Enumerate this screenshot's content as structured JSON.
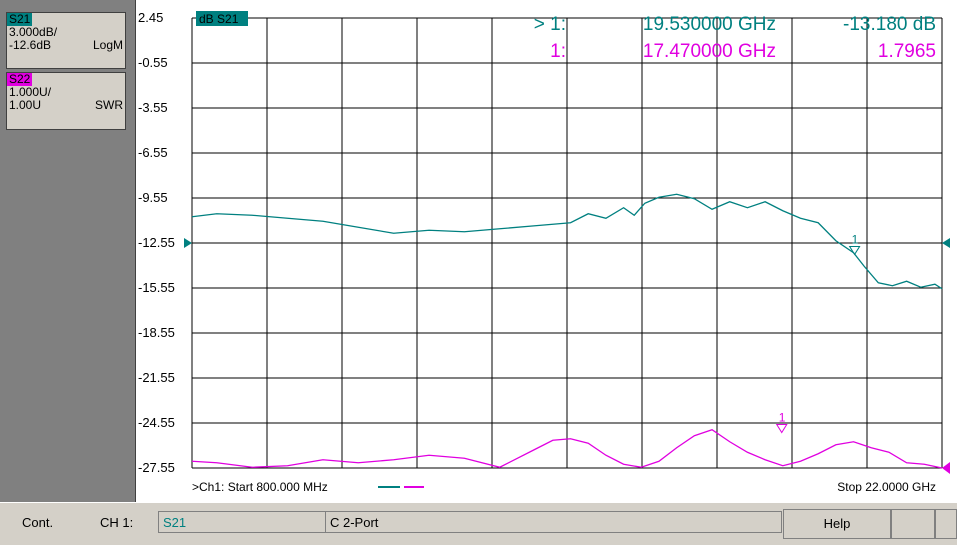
{
  "traces": [
    {
      "tag": "S21",
      "scale": "3.000dB/",
      "ref": "-12.6dB",
      "format": "LogM",
      "color": "#008080"
    },
    {
      "tag": "S22",
      "scale": "1.000U/",
      "ref": "1.00U",
      "format": "SWR",
      "color": "#e000e0"
    }
  ],
  "chart_data": {
    "type": "line",
    "title_tag": "dB S21",
    "y_ticks": [
      "2.45",
      "-0.55",
      "-3.55",
      "-6.55",
      "-9.55",
      "-12.55",
      "-15.55",
      "-18.55",
      "-21.55",
      "-24.55",
      "-27.55"
    ],
    "ylim": [
      -27.55,
      2.45
    ],
    "xlim": [
      0.8,
      22.0
    ],
    "x_unit": "GHz",
    "start_label": ">Ch1: Start  800.000 MHz",
    "stop_label": "Stop  22.0000 GHz",
    "series": [
      {
        "name": "S21",
        "color": "#008080",
        "x": [
          0.8,
          1.5,
          2.5,
          3.5,
          4.5,
          5.5,
          6.5,
          7.5,
          8.5,
          9.5,
          10.5,
          11.5,
          12.0,
          12.5,
          13.0,
          13.3,
          13.6,
          14.0,
          14.5,
          15.0,
          15.5,
          16.0,
          16.5,
          17.0,
          17.5,
          18.0,
          18.5,
          19.0,
          19.5,
          19.8,
          20.2,
          20.6,
          21.0,
          21.4,
          21.8,
          22.0
        ],
        "y": [
          -10.8,
          -10.6,
          -10.7,
          -10.9,
          -11.1,
          -11.5,
          -11.9,
          -11.7,
          -11.8,
          -11.6,
          -11.4,
          -11.2,
          -10.6,
          -10.9,
          -10.2,
          -10.7,
          -9.9,
          -9.5,
          -9.3,
          -9.6,
          -10.3,
          -9.8,
          -10.2,
          -9.8,
          -10.4,
          -10.9,
          -11.2,
          -12.4,
          -13.2,
          -14.1,
          -15.2,
          -15.4,
          -15.1,
          -15.5,
          -15.3,
          -15.6
        ]
      },
      {
        "name": "S22",
        "color": "#e000e0",
        "x": [
          0.8,
          1.5,
          2.5,
          3.5,
          4.5,
          5.5,
          6.5,
          7.5,
          8.5,
          9.5,
          10.5,
          11.0,
          11.5,
          12.0,
          12.5,
          13.0,
          13.5,
          14.0,
          14.5,
          15.0,
          15.5,
          16.0,
          16.5,
          17.0,
          17.5,
          18.0,
          18.5,
          19.0,
          19.5,
          20.0,
          20.5,
          21.0,
          21.5,
          22.0
        ],
        "y": [
          -27.1,
          -27.2,
          -27.5,
          -27.4,
          -27.0,
          -27.2,
          -27.0,
          -26.7,
          -26.9,
          -27.5,
          -26.3,
          -25.7,
          -25.6,
          -25.9,
          -26.7,
          -27.3,
          -27.5,
          -27.1,
          -26.2,
          -25.4,
          -25.0,
          -25.8,
          -26.5,
          -27.0,
          -27.4,
          -27.1,
          -26.6,
          -26.0,
          -25.8,
          -26.2,
          -26.5,
          -27.2,
          -27.3,
          -27.55
        ]
      }
    ]
  },
  "markers": [
    {
      "prefix": "> 1:",
      "freq": "19.530000 GHz",
      "value": "-13.180 dB",
      "color": "#008080",
      "x": 19.53,
      "y": -13.18,
      "label": "1"
    },
    {
      "prefix": "1:",
      "freq": "17.470000 GHz",
      "value": "1.7965",
      "color": "#e000e0",
      "x": 17.47,
      "y": -25.05,
      "label": "1"
    }
  ],
  "status_bar": {
    "mode": "Cont.",
    "channel": "CH 1:",
    "param": "S21",
    "cal": "C  2-Port",
    "help": "Help"
  }
}
